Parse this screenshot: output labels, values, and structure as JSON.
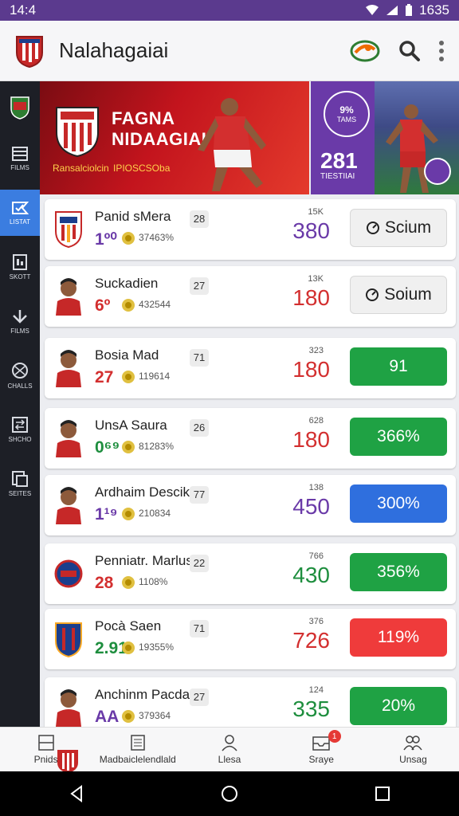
{
  "status_bar": {
    "time": "14:4",
    "right_text": "1635"
  },
  "app": {
    "title": "Nalahagaiai"
  },
  "sidebar": {
    "items": [
      {
        "label": "",
        "icon": "club-badge-icon"
      },
      {
        "label": "FILMS",
        "icon": "film-icon"
      },
      {
        "label": "LISTAT",
        "icon": "check-list-icon",
        "active": true
      },
      {
        "label": "SKOTT",
        "icon": "stats-icon"
      },
      {
        "label": "FILMS",
        "icon": "arrow-down-icon"
      },
      {
        "label": "CHALLS",
        "icon": "ball-icon"
      },
      {
        "label": "SHCHO",
        "icon": "swap-icon"
      },
      {
        "label": "SEITES",
        "icon": "settings-doc-icon"
      }
    ]
  },
  "banner": {
    "title_line1": "FAGNA",
    "title_line2": "NIDAAGIAI",
    "sub_left": "Ransalciolcin",
    "sub_right": "IPIOSCSOba",
    "badge_top": "9%",
    "badge_bottom": "TAMS",
    "big_number": "281",
    "big_sub": "TIESTIIAI"
  },
  "players": [
    {
      "name": "Panid sMera",
      "value": "1º⁰",
      "value_color": "#6a3aa8",
      "pct": "37463%",
      "chip": "28",
      "small": "15K",
      "score": "380",
      "score_color": "#6a3aa8",
      "btn": "Scium",
      "btn_style": "grey",
      "avatar": "crest"
    },
    {
      "name": "Suckadien",
      "value": "6º",
      "value_color": "#d32f2f",
      "pct": "432544",
      "chip": "27",
      "small": "13K",
      "score": "180",
      "score_color": "#d32f2f",
      "btn": "Soium",
      "btn_style": "grey",
      "avatar": "player"
    },
    {
      "name": "Bosia Mad",
      "value": "27",
      "value_color": "#d32f2f",
      "pct": "119614",
      "chip": "71",
      "small": "323",
      "score": "180",
      "score_color": "#d32f2f",
      "btn": "91",
      "btn_style": "green",
      "avatar": "player"
    },
    {
      "name": "UnsA Saura",
      "value": "0⁶⁹",
      "value_color": "#1e8e3e",
      "pct": "81283%",
      "chip": "26",
      "small": "628",
      "score": "180",
      "score_color": "#d32f2f",
      "btn": "366%",
      "btn_style": "green",
      "avatar": "player"
    },
    {
      "name": "Ardhaim Descik",
      "value": "1¹⁹",
      "value_color": "#6a3aa8",
      "pct": "210834",
      "chip": "77",
      "small": "138",
      "score": "450",
      "score_color": "#6a3aa8",
      "btn": "300%",
      "btn_style": "blue",
      "avatar": "player"
    },
    {
      "name": "Penniatr. Marluss",
      "value": "28",
      "value_color": "#d32f2f",
      "pct": "1108%",
      "chip": "22",
      "small": "766",
      "score": "430",
      "score_color": "#1e8e3e",
      "btn": "356%",
      "btn_style": "green",
      "avatar": "round-crest"
    },
    {
      "name": "Pocà Saen",
      "value": "2.91",
      "value_color": "#1e8e3e",
      "pct": "19355%",
      "chip": "71",
      "small": "376",
      "score": "726",
      "score_color": "#d32f2f",
      "btn": "119%",
      "btn_style": "red",
      "avatar": "crest2"
    },
    {
      "name": "Anchinm Pacdac",
      "value": "AA",
      "value_color": "#6a3aa8",
      "pct": "379364",
      "chip": "27",
      "small": "124",
      "score": "335",
      "score_color": "#1e8e3e",
      "btn": "20%",
      "btn_style": "green",
      "avatar": "player"
    }
  ],
  "bottom_nav": [
    {
      "label": "Pnids",
      "icon": "field-icon"
    },
    {
      "label": "Madbaiclelendlald",
      "icon": "document-icon"
    },
    {
      "label": "Llesa",
      "icon": "user-icon"
    },
    {
      "label": "Sraye",
      "icon": "inbox-icon",
      "badge": "1"
    },
    {
      "label": "Unsag",
      "icon": "group-icon"
    }
  ],
  "colors": {
    "purple": "#6a3aa8",
    "green": "#1fa244",
    "blue": "#2f6fde",
    "red": "#ef3b3b",
    "sidebar_active": "#3b7de0"
  }
}
